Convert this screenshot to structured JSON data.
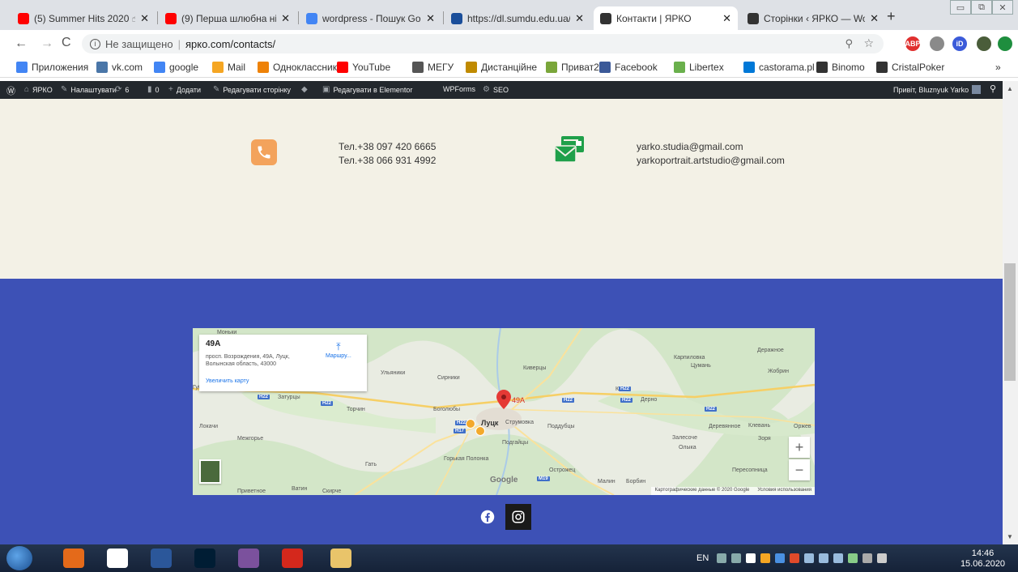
{
  "browser": {
    "tabs": [
      {
        "title": "(5) Summer Hits 2020 ☝",
        "favicon": "youtube-icon",
        "color": "#ff0000"
      },
      {
        "title": "(9) Перша шлюбна ніч г",
        "favicon": "youtube-icon",
        "color": "#ff0000"
      },
      {
        "title": "wordpress - Пошук Goog",
        "favicon": "google-icon",
        "color": "#4285f4"
      },
      {
        "title": "https://dl.sumdu.edu.ua/",
        "favicon": "sumdu-icon",
        "color": "#1a4e9a"
      },
      {
        "title": "Контакти | ЯРКО",
        "favicon": "yarko-icon",
        "color": "#333333"
      },
      {
        "title": "Сторінки ‹ ЯРКО — Wor",
        "favicon": "yarko-icon",
        "color": "#333333"
      }
    ],
    "new_tab_label": "+",
    "window_buttons": [
      "▭",
      "⧉",
      "✕"
    ],
    "address": {
      "security_label": "Не защищено",
      "url": "ярко.com/contacts/"
    },
    "toolbar_icons": [
      {
        "name": "abp-icon",
        "label": "ABP",
        "color": "#e0302f"
      },
      {
        "name": "extension-icon",
        "label": "",
        "color": "#8a8a8a"
      },
      {
        "name": "id-icon",
        "label": "iD",
        "color": "#3b5bd9"
      },
      {
        "name": "profile-avatar-icon",
        "label": "",
        "color": "#4a5d3a"
      },
      {
        "name": "update-icon",
        "label": "",
        "color": "#1e8e3e"
      }
    ],
    "bookmarks": [
      {
        "label": "Приложения",
        "icon": "apps-icon",
        "color": "#4285f4"
      },
      {
        "label": "vk.com",
        "icon": "vk-icon",
        "color": "#4a76a8"
      },
      {
        "label": "google",
        "icon": "google-icon",
        "color": "#4285f4"
      },
      {
        "label": "Mail",
        "icon": "mail-icon",
        "color": "#f5a623"
      },
      {
        "label": "Одноклассники",
        "icon": "ok-icon",
        "color": "#ee8208"
      },
      {
        "label": "YouTube",
        "icon": "youtube-icon",
        "color": "#ff0000"
      },
      {
        "label": "МЕГУ",
        "icon": "megu-icon",
        "color": "#555555"
      },
      {
        "label": "Дистанційне",
        "icon": "distance-icon",
        "color": "#c08a00"
      },
      {
        "label": "Приват24",
        "icon": "privat-icon",
        "color": "#7aa63a"
      },
      {
        "label": "Facebook",
        "icon": "facebook-icon",
        "color": "#3b5998"
      },
      {
        "label": "Libertex",
        "icon": "libertex-icon",
        "color": "#6ab04c"
      },
      {
        "label": "castorama.pl",
        "icon": "castorama-icon",
        "color": "#0078d7"
      },
      {
        "label": "Binomo",
        "icon": "binomo-icon",
        "color": "#333333"
      },
      {
        "label": "CristalPoker",
        "icon": "poker-icon",
        "color": "#333333"
      }
    ],
    "bookmarks_overflow": "»"
  },
  "adminbar": {
    "items": [
      {
        "label": "ЯРКО",
        "icon": "home-icon"
      },
      {
        "label": "Налаштувати",
        "icon": "brush-icon"
      },
      {
        "label": "6",
        "icon": "refresh-icon"
      },
      {
        "label": "0",
        "icon": "comment-icon"
      },
      {
        "label": "Додати",
        "icon": "plus-icon"
      },
      {
        "label": "Редагувати сторінку",
        "icon": "pencil-icon"
      },
      {
        "label": "",
        "icon": "diamond-icon"
      },
      {
        "label": "Редагувати в Elementor",
        "icon": "elementor-icon"
      },
      {
        "label": "WPForms",
        "icon": ""
      },
      {
        "label": "SEO",
        "icon": "gear-icon"
      }
    ],
    "greeting": "Привіт, Bluznyuk Yarko"
  },
  "contacts": {
    "phones": [
      "Тел.+38 097 420 6665",
      "Тел.+38 066 931 4992"
    ],
    "emails": [
      "yarko.studia@gmail.com",
      "yarkoportrait.artstudio@gmail.com"
    ],
    "phone_icon_color": "#f3a35c",
    "mail_icon_color": "#1fa04a"
  },
  "map": {
    "card": {
      "title": "49A",
      "address": "просп. Возрождения, 49А, Луцк, Волынская область, 43000",
      "enlarge_link": "Увеличить карту",
      "route_label": "Маршру..."
    },
    "marker_label": "49A",
    "places": [
      "Моньки",
      "Ульяники",
      "Сирники",
      "Затурцы",
      "Торчин",
      "Боголюбы",
      "Луцк",
      "Струмовка",
      "Подгайцы",
      "Поддубцы",
      "Киверцы",
      "Котов",
      "Дерно",
      "Карпиловка",
      "Цумань",
      "Жобрин",
      "Деражное",
      "Локачи",
      "Межгорье",
      "Гать",
      "Горькая Полонка",
      "Острожец",
      "Малин",
      "Борбин",
      "Залесоче",
      "Олыка",
      "Деревянное",
      "Клевань",
      "Зоря",
      "Оржев",
      "Пересопница",
      "Приветное",
      "Ватин",
      "Скирче",
      "Губин",
      "Гнидава"
    ],
    "roads": [
      "H22",
      "H22",
      "H22",
      "H22",
      "H22",
      "H22",
      "H17",
      "M19",
      "H22"
    ],
    "zoom_in": "+",
    "zoom_out": "−",
    "google_logo": "Google",
    "attribution": "Картографические данные © 2020 Google",
    "terms": "Условия использования"
  },
  "social": [
    {
      "name": "facebook",
      "color": "#3d51b6"
    },
    {
      "name": "instagram",
      "color": "#1a1a1a"
    }
  ],
  "taskbar": {
    "apps": [
      "media-player-icon",
      "chrome-icon",
      "word-icon",
      "photoshop-icon",
      "viber-icon",
      "acrobat-icon",
      "file-explorer-icon"
    ],
    "language": "EN",
    "time": "14:46",
    "date": "15.06.2020"
  }
}
